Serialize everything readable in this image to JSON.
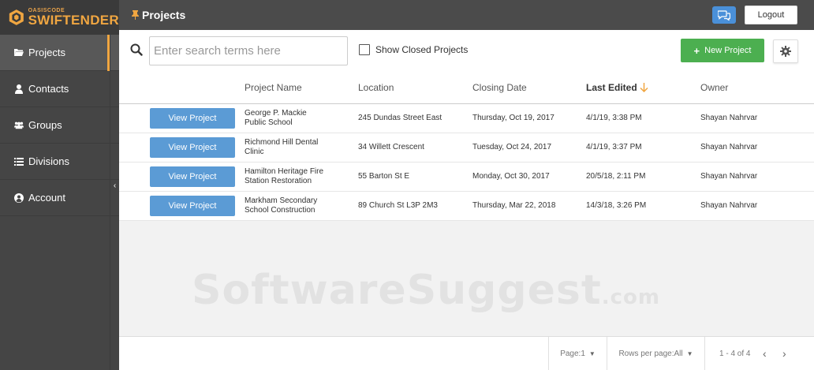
{
  "app": {
    "logo_small": "OASISCODE",
    "logo_big": "SWIFTENDER",
    "brand_color": "#f0a641"
  },
  "sidebar": {
    "items": [
      {
        "label": "Projects",
        "icon": "folder-open-icon",
        "active": true
      },
      {
        "label": "Contacts",
        "icon": "user-icon",
        "active": false
      },
      {
        "label": "Groups",
        "icon": "users-icon",
        "active": false
      },
      {
        "label": "Divisions",
        "icon": "list-icon",
        "active": false
      },
      {
        "label": "Account",
        "icon": "user-circle-icon",
        "active": false
      }
    ],
    "collapse_glyph": "‹"
  },
  "header": {
    "title": "Projects",
    "logout_label": "Logout"
  },
  "toolbar": {
    "search_placeholder": "Enter search terms here",
    "show_closed_label": "Show Closed Projects",
    "new_project_label": "New Project",
    "new_project_color": "#4caf50"
  },
  "table": {
    "columns": [
      "Project Name",
      "Location",
      "Closing Date",
      "Last Edited",
      "Owner"
    ],
    "sorted_column": "Last Edited",
    "view_button_label": "View Project",
    "view_button_color": "#5b9bd5",
    "rows": [
      {
        "name_line1": "George P. Mackie",
        "name_line2": "Public School",
        "location": "245 Dundas Street East",
        "closing": "Thursday, Oct 19, 2017",
        "edited": "4/1/19, 3:38 PM",
        "owner": "Shayan Nahrvar"
      },
      {
        "name_line1": "Richmond Hill Dental",
        "name_line2": "Clinic",
        "location": "34 Willett Crescent",
        "closing": "Tuesday, Oct 24, 2017",
        "edited": "4/1/19, 3:37 PM",
        "owner": "Shayan Nahrvar"
      },
      {
        "name_line1": "Hamilton Heritage Fire",
        "name_line2": "Station Restoration",
        "location": "55 Barton St E",
        "closing": "Monday, Oct 30, 2017",
        "edited": "20/5/18, 2:11 PM",
        "owner": "Shayan Nahrvar"
      },
      {
        "name_line1": "Markham Secondary",
        "name_line2": "School Construction",
        "location": "89 Church St L3P 2M3",
        "closing": "Thursday, Mar 22, 2018",
        "edited": "14/3/18, 3:26 PM",
        "owner": "Shayan Nahrvar"
      }
    ]
  },
  "watermark": {
    "main": "SoftwareSuggest",
    "suffix": ".com"
  },
  "footer": {
    "page_label": "Page:1",
    "rows_per_page_label": "Rows per page:All",
    "range_label": "1 - 4 of 4",
    "prev_glyph": "‹",
    "next_glyph": "›"
  }
}
